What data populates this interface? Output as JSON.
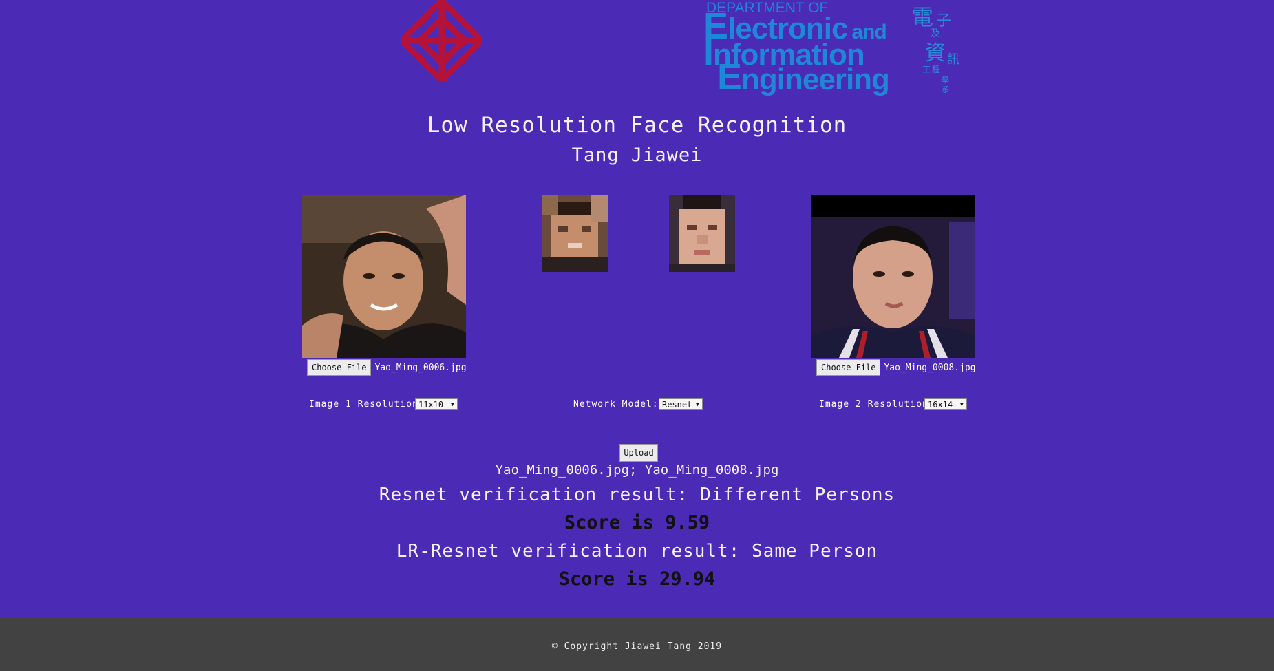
{
  "header": {
    "polyu_logo_icon": "polyu-knot-logo",
    "eie_logo": {
      "dept": "DEPARTMENT OF",
      "line1": "lectronic",
      "line1_and": "and",
      "line2": "nformation",
      "line3": "ngineering",
      "cn": [
        "電",
        "子",
        "及",
        "資",
        "訊",
        "工",
        "程",
        "學",
        "系"
      ]
    },
    "title": "Low Resolution Face Recognition",
    "author": "Tang Jiawei"
  },
  "image1": {
    "choose_label": "Choose File",
    "filename": "Yao_Ming_0006.jpg",
    "resolution_label": "Image 1 Resolution:",
    "resolution_value": "11x10"
  },
  "image2": {
    "choose_label": "Choose File",
    "filename": "Yao_Ming_0008.jpg",
    "resolution_label": "Image 2 Resolution:",
    "resolution_value": "16x14"
  },
  "model": {
    "label": "Network Model:",
    "value": "Resnet"
  },
  "upload_label": "Upload",
  "results": {
    "filenames": "Yao_Ming_0006.jpg; Yao_Ming_0008.jpg",
    "resnet_result": "Resnet verification result: Different Persons",
    "resnet_score": "Score is 9.59",
    "lr_result": "LR-Resnet verification result: Same Person",
    "lr_score": "Score is 29.94"
  },
  "footer": {
    "copyright": "© Copyright Jiawei Tang 2019"
  },
  "colors": {
    "background": "#4b2ab5",
    "footer": "#424242",
    "polyu_red": "#b5123a",
    "eie_blue": "#1f86d8"
  }
}
